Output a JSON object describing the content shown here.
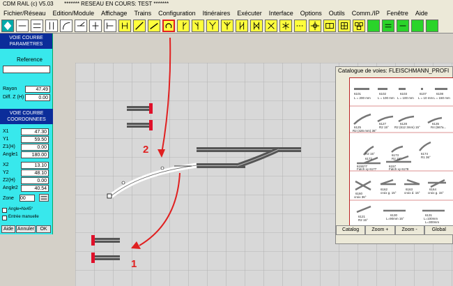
{
  "window": {
    "title": "CDM RAIL (c) V5.03       ******* RESEAU EN COURS: TEST *******"
  },
  "menu": [
    "Fichier/Réseau",
    "Edition/Module",
    "Affichage",
    "Trains",
    "Configuration",
    "Itinéraires",
    "Exécuter",
    "Interface",
    "Options",
    "Outils",
    "Comm./IP",
    "Fenêtre",
    "Aide"
  ],
  "panel": {
    "header1": "VOIE COURBE\nPARAMETRES",
    "reference_label": "Reference",
    "reference_value": "",
    "rayon_label": "Rayon",
    "rayon_value": "47.49",
    "diffz_label": "Diff. Z (H)",
    "diffz_value": "0.00",
    "header2": "VOIE COURBE\nCOORDONNEES",
    "x1_label": "X1",
    "x1_value": "47.30",
    "y1_label": "Y1",
    "y1_value": "59.50",
    "z1_label": "Z1(H)",
    "z1_value": "0.00",
    "angle1_label": "Angle1",
    "angle1_value": "180.00",
    "x2_label": "X2",
    "x2_value": "13.10",
    "y2_label": "Y2",
    "y2_value": "48.10",
    "z2_label": "Z2(H)",
    "z2_value": "0.00",
    "angle2_label": "Angle2",
    "angle2_value": "40.54",
    "zone_label": "Zone",
    "zone_value": "00",
    "angle_check": "Angle=Nx45°",
    "manual_check": "Entrée manuelle",
    "btn_aide": "Aide",
    "btn_annuler": "Annuler",
    "btn_ok": "OK"
  },
  "catalog": {
    "title": "Catalogue de voies: FLEISCHMANN_PROFI",
    "items": [
      {
        "code": "6101",
        "desc": "L = 200 mm"
      },
      {
        "code": "6102",
        "desc": "L = 100 mm"
      },
      {
        "code": "6103",
        "desc": "L = 100 mm"
      },
      {
        "code": "6107",
        "desc": "L = 10 mm"
      },
      {
        "code": "6108",
        "desc": "L = 150 mm"
      },
      {
        "code": "6125",
        "desc": "R2 (426 mm) 36°"
      },
      {
        "code": "6127",
        "desc": "R2 15°"
      },
      {
        "code": "6128",
        "desc": "R2 (612 3mm) 15°"
      },
      {
        "code": "6135",
        "desc": "R4 (567a..."
      },
      {
        "code": "6172",
        "desc": "R2 15°"
      },
      {
        "code": "6173",
        "desc": "R2 15°"
      },
      {
        "code": "6174",
        "desc": "R1 36°"
      },
      {
        "code": "6155?7",
        "desc": "Fatch xy 6177"
      },
      {
        "code": "6157",
        "desc": "Fatch xy 6178"
      },
      {
        "code": "6160",
        "desc": "croix 36°"
      },
      {
        "code": "6162",
        "desc": "croix g. 15°"
      },
      {
        "code": "6163",
        "desc": "croix d. 15°"
      },
      {
        "code": "6164",
        "desc": "croix g. 15°"
      },
      {
        "code": "6121",
        "desc": "R2 15°"
      },
      {
        "code": "6130",
        "desc": "L=90mm 15°"
      },
      {
        "code": "6131",
        "desc": "L=100mm"
      },
      {
        "code": "6131",
        "desc": "L=300mm"
      }
    ],
    "buttons": [
      "Catalog",
      "Zoom +",
      "Zoom -",
      "Global"
    ]
  },
  "annotations": {
    "label_1": "1",
    "label_2": "2"
  }
}
